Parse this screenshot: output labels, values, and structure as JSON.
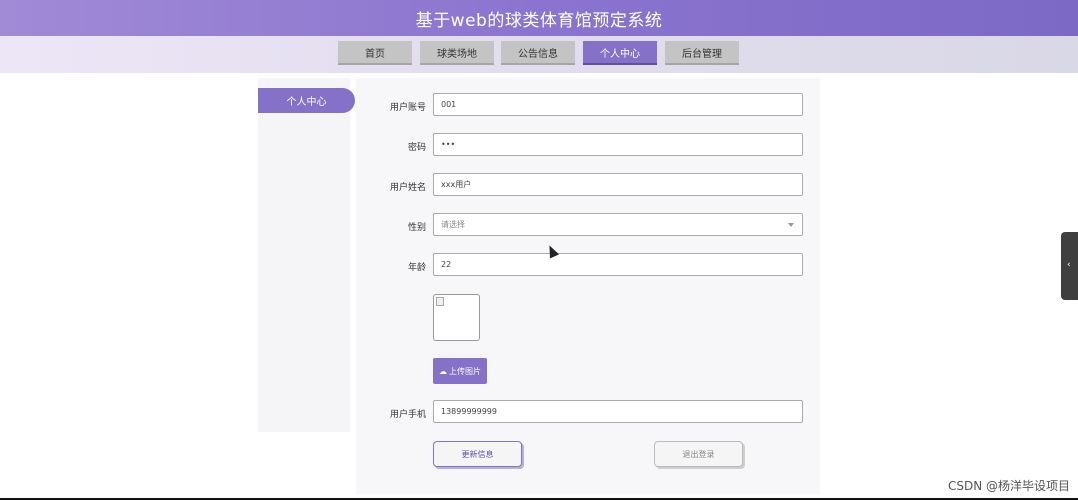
{
  "header": {
    "title": "基于web的球类体育馆预定系统"
  },
  "nav": {
    "tabs": [
      {
        "label": "首页"
      },
      {
        "label": "球类场地"
      },
      {
        "label": "公告信息"
      },
      {
        "label": "个人中心",
        "active": true
      },
      {
        "label": "后台管理"
      }
    ]
  },
  "sidebar": {
    "items": [
      {
        "label": "个人中心",
        "active": true
      }
    ]
  },
  "form": {
    "account_label": "用户账号",
    "account_value": "001",
    "password_label": "密码",
    "password_value": "•••",
    "name_label": "用户姓名",
    "name_value": "xxx用户",
    "gender_label": "性别",
    "gender_placeholder": "请选择",
    "age_label": "年龄",
    "age_value": "22",
    "upload_label": "上传图片",
    "phone_label": "用户手机",
    "phone_value": "13899999999"
  },
  "actions": {
    "update_label": "更新信息",
    "logout_label": "退出登录"
  },
  "watermark": "CSDN @杨洋毕设项目",
  "colors": {
    "accent": "#8571c8",
    "header": "#8a74cf",
    "inactive_tab": "#c4c4c4"
  },
  "icons": {
    "upload": "cloud-upload-icon",
    "float": "chevron-left-icon",
    "select": "chevron-down-icon"
  }
}
